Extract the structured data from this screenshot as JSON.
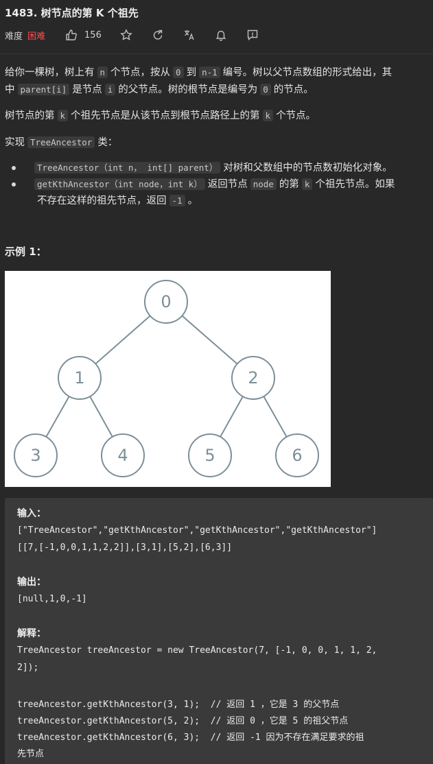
{
  "header": {
    "title": "1483. 树节点的第 K 个祖先",
    "difficulty_label": "难度",
    "difficulty": "困难",
    "likes": "156"
  },
  "icons": {
    "like": "thumbs-up-icon",
    "favorite": "star-icon",
    "share": "share-icon",
    "translate": "translate-icon",
    "notify": "bell-icon",
    "feedback": "feedback-icon"
  },
  "desc": {
    "p1a": "给你一棵树，树上有",
    "p1_code1": "n",
    "p1b": "个节点，按从",
    "p1_code2": "0",
    "p1c": "到",
    "p1_code3": "n-1",
    "p1d": "编号。树以父节点数组的形式给出，其",
    "p1e": "中",
    "p1_code4": "parent[i]",
    "p1f": "是节点",
    "p1_code5": "i",
    "p1g": "的父节点。树的根节点是编号为",
    "p1_code6": "0",
    "p1h": "的节点。",
    "p2a": "树节点的第",
    "p2_code1": "k",
    "p2b": "个祖先节点是从该节点到根节点路径上的第",
    "p2_code2": "k",
    "p2c": "个节点。",
    "p3a": "实现",
    "p3_code": "TreeAncestor",
    "p3b": "类：",
    "b1_code": "TreeAncestor（int n， int[] parent）",
    "b1_text": "对树和父数组中的节点数初始化对象。",
    "b2_code1": "getKthAncestor（int node，int k）",
    "b2_text1": "返回节点",
    "b2_code2": "node",
    "b2_text2": "的第",
    "b2_code3": "k",
    "b2_text3": "个祖先节点。如果",
    "b2_text4": "不存在这样的祖先节点，返回",
    "b2_code4": "-1",
    "b2_text5": "。"
  },
  "example": {
    "heading": "示例 1：",
    "tree_nodes": [
      "0",
      "1",
      "2",
      "3",
      "4",
      "5",
      "6"
    ]
  },
  "code": {
    "input_label": "输入：",
    "input_line1": "[\"TreeAncestor\",\"getKthAncestor\",\"getKthAncestor\",\"getKthAncestor\"]",
    "input_line2": "[[7,[-1,0,0,1,1,2,2]],[3,1],[5,2],[6,3]]",
    "output_label": "输出：",
    "output_line": "[null,1,0,-1]",
    "explain_label": "解释：",
    "explain_line1": "TreeAncestor treeAncestor = new TreeAncestor(7, [-1, 0, 0, 1, 1, 2,",
    "explain_line2": "2]);",
    "call1": "treeAncestor.getKthAncestor(3, 1);  // 返回 1 ，它是 3 的父节点",
    "call2": "treeAncestor.getKthAncestor(5, 2);  // 返回 0 ，它是 5 的祖父节点",
    "call3": "treeAncestor.getKthAncestor(6, 3);  // 返回 -1 因为不存在满足要求的祖",
    "call3_cont": "先节点"
  }
}
